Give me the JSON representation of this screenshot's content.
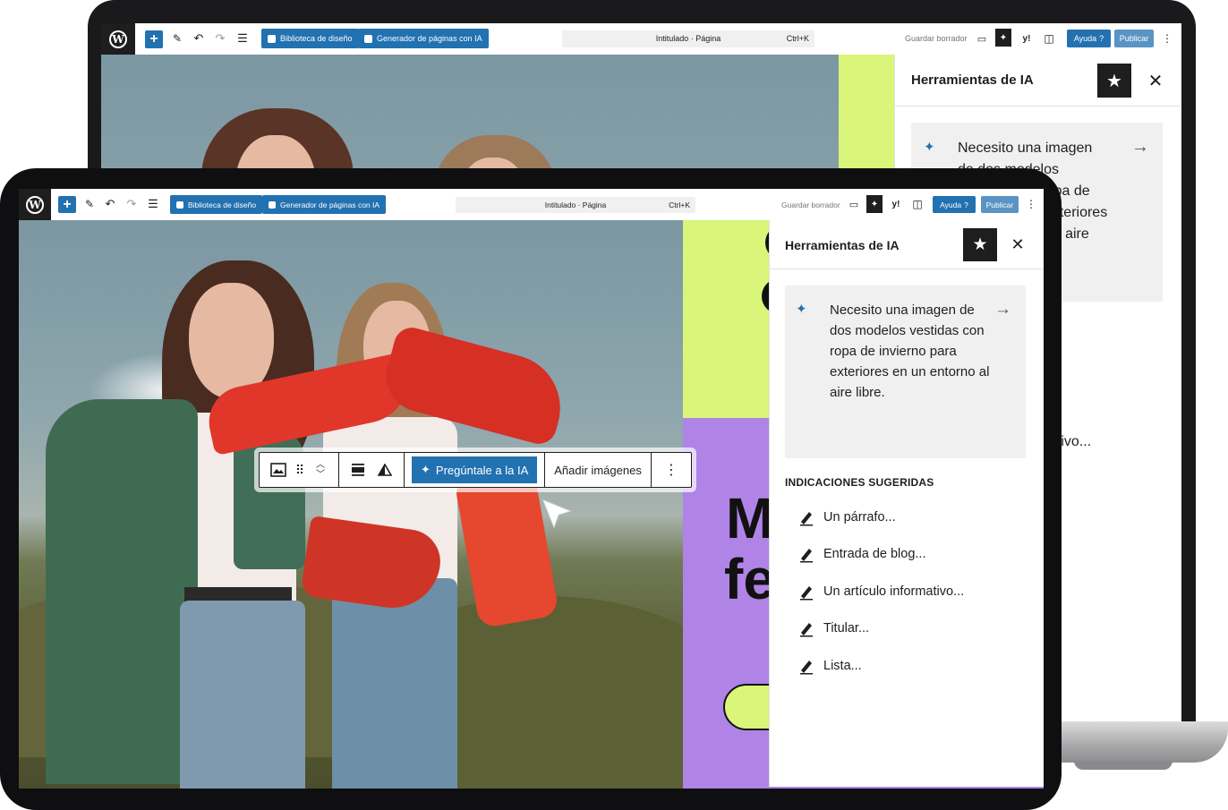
{
  "editor": {
    "title": "Intitulado · Página",
    "shortcut": "Ctrl+K",
    "design_library_label": "Biblioteca de diseño",
    "page_generator_label": "Generador de páginas con IA",
    "save_draft_label": "Guardar borrador",
    "help_label": "Ayuda",
    "publish_label": "Publicar"
  },
  "panel": {
    "title": "Herramientas de IA",
    "prompt_text": "Necesito una imagen de dos modelos vestidas con ropa de invierno para exteriores en un entorno al aire libre.",
    "back_prompt_lines": [
      "Necesito una imagen",
      "de dos modelos",
      "vestidas con ropa de",
      "invierno para exteriores",
      "en un entorno al aire"
    ],
    "suggestions_title": "INDICACIONES SUGERIDAS",
    "suggestions": [
      {
        "label": "Un párrafo..."
      },
      {
        "label": "Entrada de blog..."
      },
      {
        "label": "Un artículo informativo..."
      },
      {
        "label": "Titular..."
      },
      {
        "label": "Lista..."
      }
    ],
    "back_partial_text": "ativo..."
  },
  "block_toolbar": {
    "ask_ai_label": "Pregúntale a la IA",
    "add_images_label": "Añadir imágenes"
  },
  "canvas": {
    "heading_partial_1": "M",
    "heading_partial_2": "fe"
  },
  "colors": {
    "accent": "#2271b1",
    "lime": "#d9f57a",
    "purple": "#b083e6",
    "dark": "#1e1e1e"
  }
}
